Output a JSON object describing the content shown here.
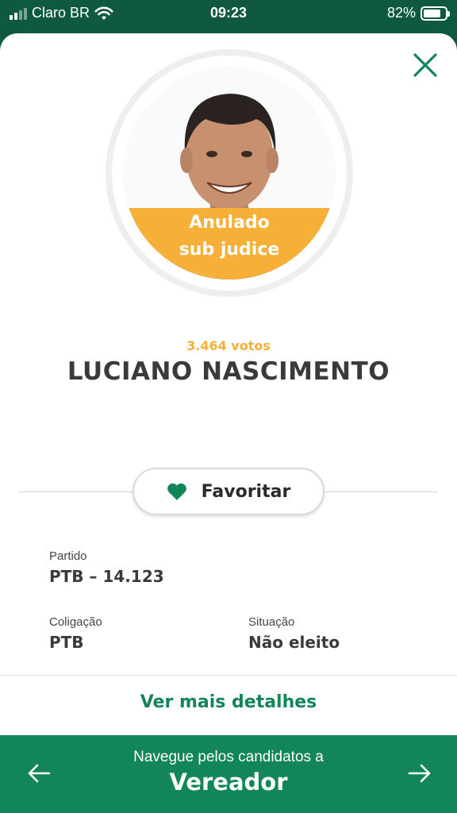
{
  "status_bar": {
    "carrier": "Claro BR",
    "time": "09:23",
    "battery": "82%",
    "battery_level": 0.82
  },
  "candidate": {
    "status_line1": "Anulado",
    "status_line2": "sub judice",
    "votes": "3.464 votos",
    "name": "LUCIANO NASCIMENTO"
  },
  "favorite": {
    "label": "Favoritar"
  },
  "details": {
    "partido_label": "Partido",
    "partido_value": "PTB – 14.123",
    "coligacao_label": "Coligação",
    "coligacao_value": "PTB",
    "situacao_label": "Situação",
    "situacao_value": "Não eleito"
  },
  "more_details_label": "Ver mais detalhes",
  "bottom_nav": {
    "subtitle": "Navegue pelos candidatos a",
    "title": "Vereador"
  },
  "colors": {
    "dark_green": "#0f5a3f",
    "brand_green": "#128559",
    "accent_orange": "#f6af37"
  },
  "icons": [
    "signal-icon",
    "wifi-icon",
    "battery-icon",
    "close-icon",
    "heart-icon",
    "arrow-left-icon",
    "arrow-right-icon"
  ]
}
